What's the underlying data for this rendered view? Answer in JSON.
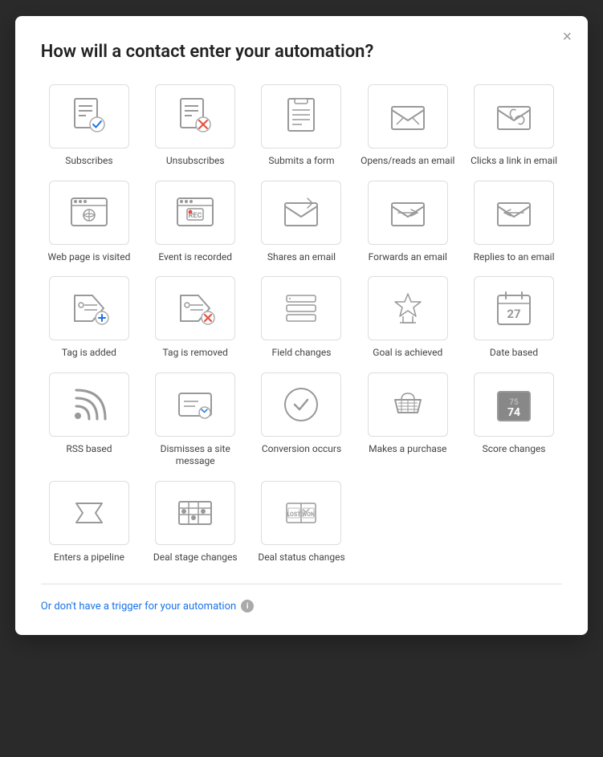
{
  "modal": {
    "title": "How will a contact enter your automation?",
    "close_label": "×",
    "footer_link": "Or don't have a trigger for your automation",
    "info_icon": "i"
  },
  "triggers": [
    {
      "id": "subscribes",
      "label": "Subscribes"
    },
    {
      "id": "unsubscribes",
      "label": "Unsubscribes"
    },
    {
      "id": "submits-form",
      "label": "Submits a form"
    },
    {
      "id": "opens-email",
      "label": "Opens/reads an email"
    },
    {
      "id": "clicks-link",
      "label": "Clicks a link in email"
    },
    {
      "id": "web-page-visited",
      "label": "Web page is visited"
    },
    {
      "id": "event-recorded",
      "label": "Event is recorded"
    },
    {
      "id": "shares-email",
      "label": "Shares an email"
    },
    {
      "id": "forwards-email",
      "label": "Forwards an email"
    },
    {
      "id": "replies-email",
      "label": "Replies to an email"
    },
    {
      "id": "tag-added",
      "label": "Tag is added"
    },
    {
      "id": "tag-removed",
      "label": "Tag is removed"
    },
    {
      "id": "field-changes",
      "label": "Field changes"
    },
    {
      "id": "goal-achieved",
      "label": "Goal is achieved"
    },
    {
      "id": "date-based",
      "label": "Date based"
    },
    {
      "id": "rss-based",
      "label": "RSS based"
    },
    {
      "id": "dismisses-site",
      "label": "Dismisses a site message"
    },
    {
      "id": "conversion-occurs",
      "label": "Conversion occurs"
    },
    {
      "id": "makes-purchase",
      "label": "Makes a purchase"
    },
    {
      "id": "score-changes",
      "label": "Score changes"
    },
    {
      "id": "enters-pipeline",
      "label": "Enters a pipeline"
    },
    {
      "id": "deal-stage",
      "label": "Deal stage changes"
    },
    {
      "id": "deal-status",
      "label": "Deal status changes"
    }
  ]
}
